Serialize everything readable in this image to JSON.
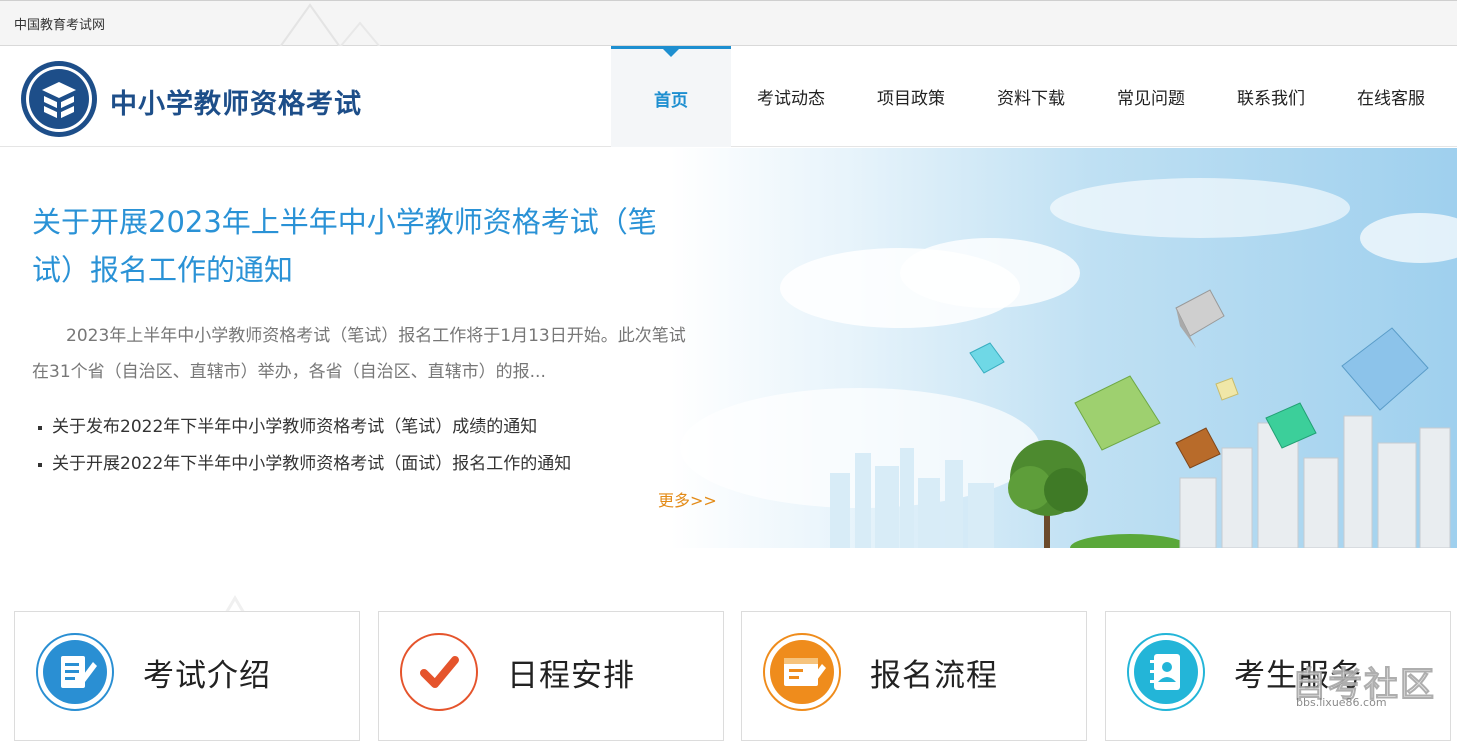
{
  "topbar": {
    "site_name": "中国教育考试网"
  },
  "header": {
    "title": "中小学教师资格考试",
    "nav": [
      {
        "label": "首页",
        "active": true
      },
      {
        "label": "考试动态",
        "active": false
      },
      {
        "label": "项目政策",
        "active": false
      },
      {
        "label": "资料下载",
        "active": false
      },
      {
        "label": "常见问题",
        "active": false
      },
      {
        "label": "联系我们",
        "active": false
      },
      {
        "label": "在线客服",
        "active": false
      }
    ]
  },
  "banner": {
    "headline": "关于开展2023年上半年中小学教师资格考试（笔试）报名工作的通知",
    "summary": "2023年上半年中小学教师资格考试（笔试）报名工作将于1月13日开始。此次笔试在31个省（自治区、直辖市）举办，各省（自治区、直辖市）的报...",
    "news": [
      "关于发布2022年下半年中小学教师资格考试（笔试）成绩的通知",
      "关于开展2022年下半年中小学教师资格考试（面试）报名工作的通知"
    ],
    "more": "更多>>"
  },
  "cards": [
    {
      "label": "考试介绍",
      "icon": "document-edit-icon",
      "color": "#2a8fd3"
    },
    {
      "label": "日程安排",
      "icon": "checkmark-icon",
      "color": "#e5542c"
    },
    {
      "label": "报名流程",
      "icon": "form-edit-icon",
      "color": "#ef8c1c"
    },
    {
      "label": "考生服务",
      "icon": "contact-book-icon",
      "color": "#23b5d8"
    }
  ],
  "watermark": {
    "text": "自考社区",
    "url": "bbs.lixue86.com"
  },
  "colors": {
    "accent": "#1e8fd0",
    "brand": "#1d4e89",
    "more": "#e38b17"
  }
}
